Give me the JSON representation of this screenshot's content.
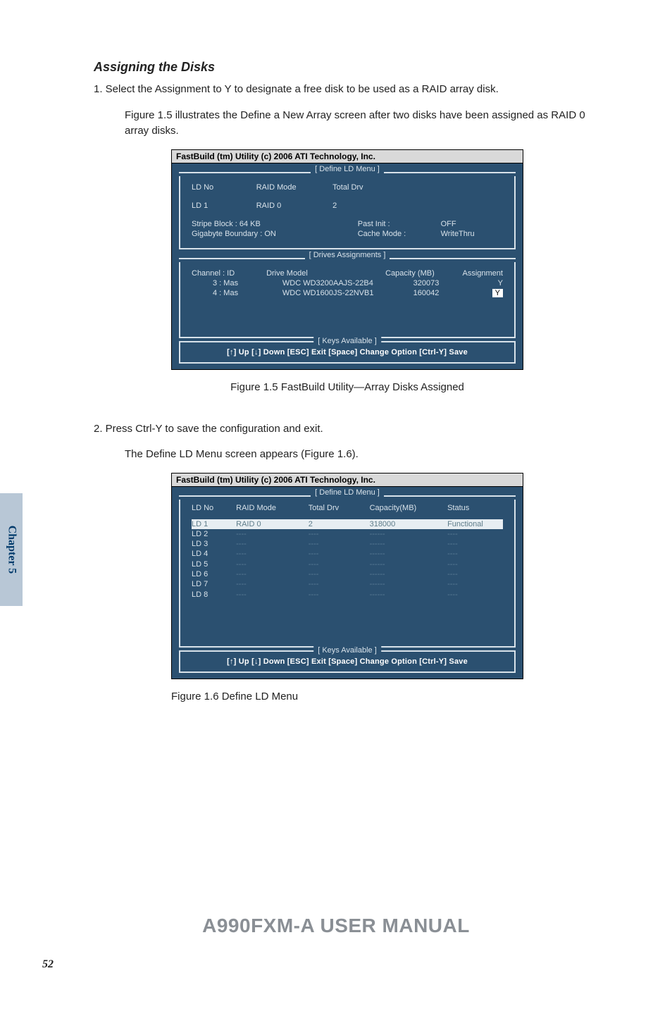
{
  "heading": "Assigning the Disks",
  "step1": "1. Select the Assignment to Y to designate a free disk to be used as a RAID array disk.",
  "step1_detail": "Figure 1.5 illustrates the Define a New Array screen after two disks have been assigned as RAID 0 array disks.",
  "bios1": {
    "title": "FastBuild (tm) Utility (c) 2006 ATI Technology, Inc.",
    "section_define": {
      "label": "[  Define LD Menu  ]",
      "headerRow": {
        "c1": "LD No",
        "c2": "RAID Mode",
        "c3": "Total Drv"
      },
      "dataRow": {
        "c1": "LD 1",
        "c2": "RAID 0",
        "c3": "2"
      },
      "stripe": "Stripe Block :                64  KB",
      "gigabyte": "Gigabyte Boundary : ON",
      "pastInit": "Past Init :",
      "pastInitVal": "OFF",
      "cacheMode": "Cache Mode :",
      "cacheModeVal": "WriteThru"
    },
    "section_drives": {
      "label": "[ Drives Assignments ]",
      "headerRow": {
        "c1": "Channel : ID",
        "c2": "Drive Model",
        "c3": "Capacity (MB)",
        "c4": "Assignment"
      },
      "rows": [
        {
          "channel": "3 : Mas",
          "model": "WDC  WD3200AAJS-22B4",
          "capacity": "320073",
          "assign": "Y"
        },
        {
          "channel": "4 : Mas",
          "model": "WDC  WD1600JS-22NVB1",
          "capacity": "160042",
          "assign": "Y"
        }
      ]
    },
    "keys": {
      "label": "[ Keys Available ]",
      "text": "[↑] Up  [↓] Down  [ESC] Exit   [Space] Change Option   [Ctrl-Y] Save"
    }
  },
  "caption1": "Figure 1.5   FastBuild Utility—Array Disks Assigned",
  "step2": "2. Press Ctrl-Y to save the configuration and exit.",
  "step2_detail": "The Define LD Menu screen appears (Figure 1.6).",
  "bios2": {
    "title": "FastBuild (tm) Utility (c) 2006 ATI Technology, Inc.",
    "section_label": "[  Define LD Menu  ]",
    "headers": {
      "h1": "LD No",
      "h2": "RAID Mode",
      "h3": "Total Drv",
      "h4": "Capacity(MB)",
      "h5": "Status"
    },
    "rows": [
      {
        "ld": "LD 1",
        "mode": "RAID 0",
        "drv": "2",
        "cap": "318000",
        "status": "Functional",
        "highlight": true
      },
      {
        "ld": "LD 2",
        "mode": "----",
        "drv": "----",
        "cap": "------",
        "status": "----"
      },
      {
        "ld": "LD 3",
        "mode": "----",
        "drv": "----",
        "cap": "------",
        "status": "----"
      },
      {
        "ld": "LD 4",
        "mode": "----",
        "drv": "----",
        "cap": "------",
        "status": "----"
      },
      {
        "ld": "LD 5",
        "mode": "----",
        "drv": "----",
        "cap": "------",
        "status": "----"
      },
      {
        "ld": "LD 6",
        "mode": "----",
        "drv": "----",
        "cap": "------",
        "status": "----"
      },
      {
        "ld": "LD 7",
        "mode": "----",
        "drv": "----",
        "cap": "------",
        "status": "----"
      },
      {
        "ld": "LD 8",
        "mode": "----",
        "drv": "----",
        "cap": "------",
        "status": "----"
      }
    ],
    "keys": {
      "label": "[ Keys Available ]",
      "text": "[↑] Up   [↓] Down   [ESC] Exit   [Space] Change Option   [Ctrl-Y] Save"
    }
  },
  "caption2": "Figure 1.6   Define LD Menu",
  "footer": "A990FXM-A USER MANUAL",
  "chapterTab": "Chapter 5",
  "pageNum": "52"
}
